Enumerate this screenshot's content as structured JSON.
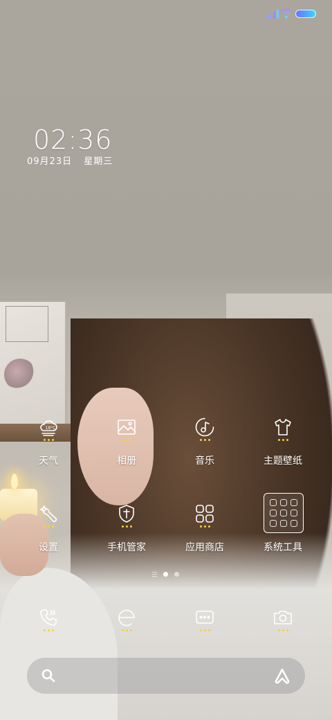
{
  "status_bar": {
    "signal": "signal-bars-icon",
    "wifi": "wifi-icon",
    "battery": "battery-icon",
    "battery_colors": [
      "#6d72ff",
      "#3ad7ff"
    ]
  },
  "clock": {
    "time": "02:36",
    "date": "09月23日",
    "weekday": "星期三"
  },
  "apps": {
    "weather": {
      "label": "天气",
      "icon": "weather-icon",
      "temp": "18°C"
    },
    "gallery": {
      "label": "相册",
      "icon": "gallery-icon"
    },
    "music": {
      "label": "音乐",
      "icon": "music-icon"
    },
    "themes": {
      "label": "主题壁纸",
      "icon": "tshirt-icon"
    },
    "settings": {
      "label": "设置",
      "icon": "wrench-icon"
    },
    "phone_manager": {
      "label": "手机管家",
      "icon": "shield-icon"
    },
    "app_store": {
      "label": "应用商店",
      "icon": "apps-grid-icon"
    },
    "system_tools": {
      "label": "系统工具",
      "icon": "folder-icon"
    }
  },
  "page_indicator": {
    "pages": 2,
    "active": 1
  },
  "dock": [
    "phone-icon",
    "browser-icon",
    "messages-icon",
    "camera-icon"
  ],
  "search_bar": {
    "left_icon": "search-icon",
    "right_icon": "assistant-icon"
  },
  "accent_dot_color": "#f4d23a"
}
